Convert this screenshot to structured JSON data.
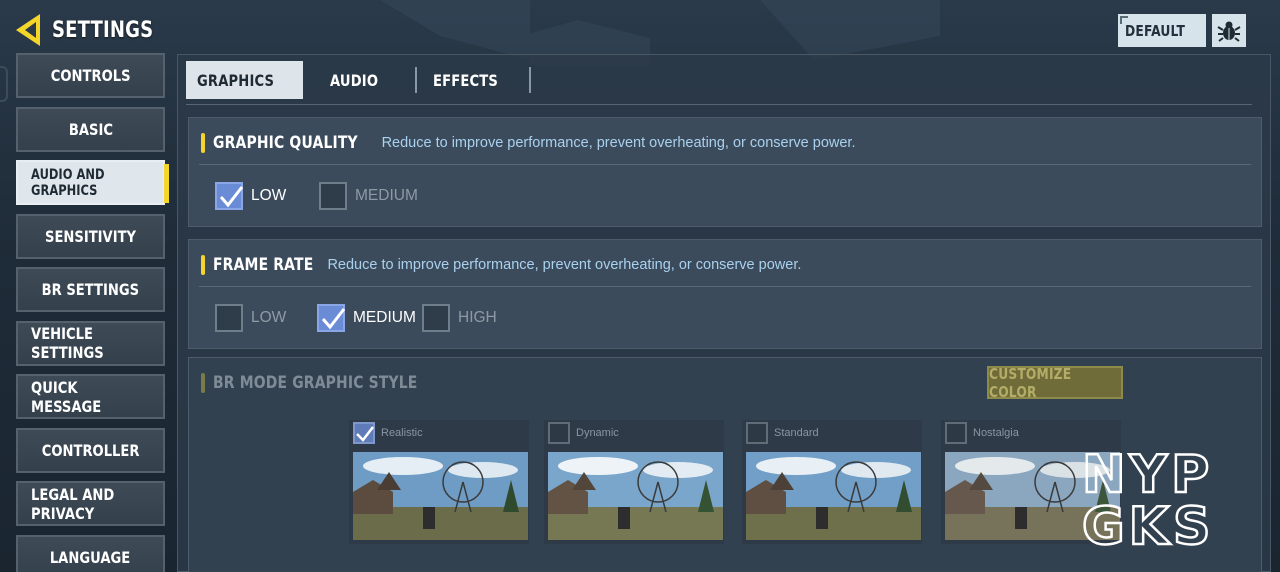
{
  "header": {
    "title": "SETTINGS",
    "back_icon": "back-arrow-icon"
  },
  "top_right": {
    "default_label": "DEFAULT",
    "bug_icon": "bug-icon"
  },
  "sidebar": {
    "items": [
      {
        "label": "CONTROLS",
        "active": false
      },
      {
        "label": "BASIC",
        "active": false
      },
      {
        "label": "AUDIO AND GRAPHICS",
        "active": true
      },
      {
        "label": "SENSITIVITY",
        "active": false
      },
      {
        "label": "BR SETTINGS",
        "active": false
      },
      {
        "label": "VEHICLE SETTINGS",
        "active": false
      },
      {
        "label": "QUICK MESSAGE",
        "active": false
      },
      {
        "label": "CONTROLLER",
        "active": false
      },
      {
        "label": "LEGAL AND PRIVACY",
        "active": false
      },
      {
        "label": "LANGUAGE",
        "active": false
      }
    ]
  },
  "tabs": [
    {
      "label": "GRAPHICS",
      "active": true
    },
    {
      "label": "AUDIO",
      "active": false
    },
    {
      "label": "EFFECTS",
      "active": false
    }
  ],
  "graphic_quality": {
    "title": "GRAPHIC QUALITY",
    "description": "Reduce to improve performance, prevent overheating, or conserve power.",
    "options": [
      {
        "label": "LOW",
        "checked": true
      },
      {
        "label": "MEDIUM",
        "checked": false
      }
    ]
  },
  "frame_rate": {
    "title": "FRAME RATE",
    "description": "Reduce to improve performance, prevent overheating, or conserve power.",
    "options": [
      {
        "label": "LOW",
        "checked": false
      },
      {
        "label": "MEDIUM",
        "checked": true
      },
      {
        "label": "HIGH",
        "checked": false
      }
    ]
  },
  "br_mode": {
    "title": "BR MODE GRAPHIC STYLE",
    "customize_label": "CUSTOMIZE COLOR",
    "styles": [
      {
        "name": "Realistic",
        "checked": true
      },
      {
        "name": "Dynamic",
        "checked": false
      },
      {
        "name": "Standard",
        "checked": false
      },
      {
        "name": "Nostalgia",
        "checked": false
      }
    ]
  },
  "watermark": {
    "line1": "NYP",
    "line2": "GKS"
  },
  "colors": {
    "accent_yellow": "#f4d52a",
    "check_blue": "#6a8bd6",
    "desc_blue": "#a9d1ee"
  }
}
